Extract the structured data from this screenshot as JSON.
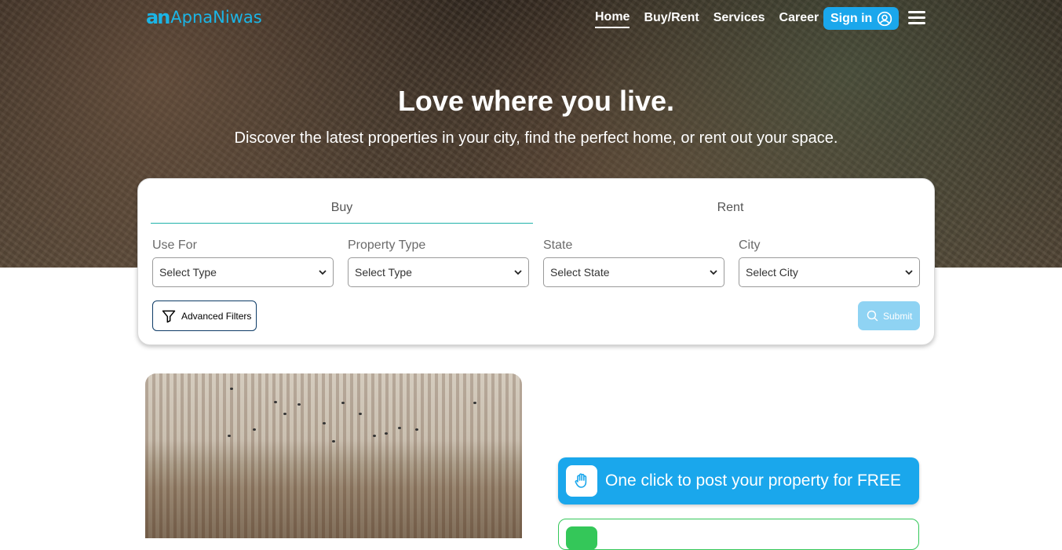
{
  "brand": {
    "mark": "an",
    "name": "ApnaNiwas"
  },
  "nav": {
    "links": [
      "Home",
      "Buy/Rent",
      "Services",
      "Career"
    ],
    "signin_label": "Sign in"
  },
  "hero": {
    "title": "Love where you live.",
    "subtitle": "Discover the latest properties in your city, find the perfect home, or rent out your space."
  },
  "search": {
    "tabs": [
      "Buy",
      "Rent"
    ],
    "active_tab": "Buy",
    "fields": [
      {
        "label": "Use For",
        "value": "Select Type"
      },
      {
        "label": "Property Type",
        "value": "Select Type"
      },
      {
        "label": "State",
        "value": "Select State"
      },
      {
        "label": "City",
        "value": "Select City"
      }
    ],
    "advanced_filters_label": "Advanced Filters",
    "submit_label": "Submit"
  },
  "promo": {
    "post_property_label": "One click to post your property for FREE"
  },
  "colors": {
    "primary": "#1aa7ec",
    "submit_disabled": "#8fd3f3",
    "tab_underline": "#20b2aa",
    "accent_green": "#34c759"
  }
}
